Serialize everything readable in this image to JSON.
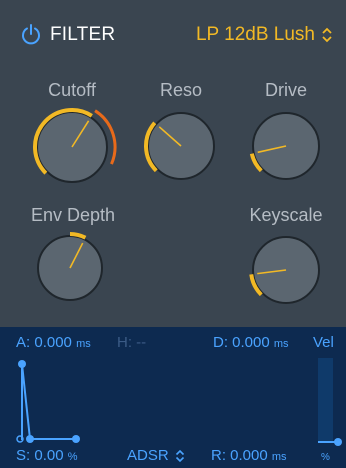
{
  "header": {
    "power_icon": "power-icon",
    "title": "FILTER",
    "mode": "LP 12dB Lush",
    "mode_arrow": "⌃⌄"
  },
  "knobs": {
    "cutoff": {
      "label": "Cutoff",
      "value": 0.62,
      "mod_range": 0.3
    },
    "reso": {
      "label": "Reso",
      "value": 0.32
    },
    "drive": {
      "label": "Drive",
      "value": 0.12
    },
    "env_depth": {
      "label": "Env Depth",
      "value": 0.6,
      "bipolar": true
    },
    "keyscale": {
      "label": "Keyscale",
      "value": 0.14
    }
  },
  "envelope": {
    "attack_label": "A:",
    "attack_value": "0.000",
    "attack_unit": "ms",
    "hold_label": "H:",
    "hold_value": "--",
    "decay_label": "D:",
    "decay_value": "0.000",
    "decay_unit": "ms",
    "sustain_label": "S:",
    "sustain_value": "0.00",
    "sustain_unit": "%",
    "mode": "ADSR",
    "mode_arrow": "⌃⌄",
    "release_label": "R:",
    "release_value": "0.000",
    "release_unit": "ms",
    "velocity_label": "Vel",
    "velocity_unit": "%",
    "velocity_value": 0.0
  },
  "colors": {
    "background": "#3a4550",
    "accent_yellow": "#f2b925",
    "accent_orange": "#e86a1a",
    "env_bg": "#0d2a50",
    "env_blue": "#4aa3ff"
  }
}
